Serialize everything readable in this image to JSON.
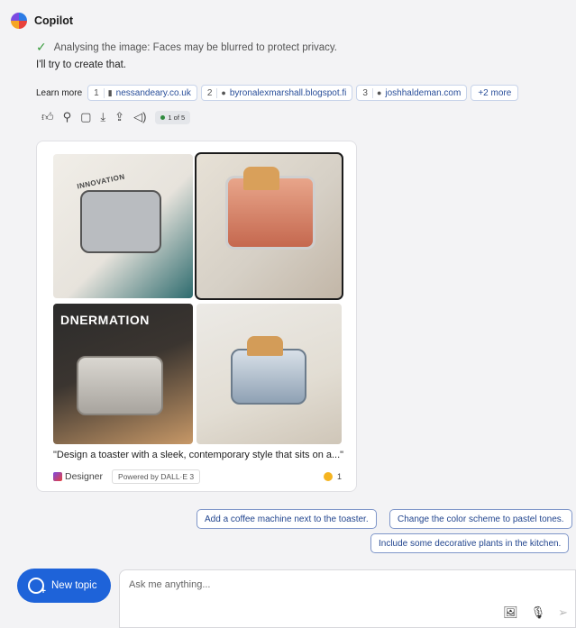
{
  "header": {
    "title": "Copilot"
  },
  "status": {
    "text": "Analysing the image: Faces may be blurred to protect privacy."
  },
  "reply": {
    "text": "I'll try to create that."
  },
  "learn_more": {
    "label": "Learn more",
    "sources": [
      {
        "num": "1",
        "name": "nessandeary.co.uk"
      },
      {
        "num": "2",
        "name": "byronalexmarshall.blogspot.fi"
      },
      {
        "num": "3",
        "name": "joshhaldeman.com"
      }
    ],
    "more_label": "+2 more"
  },
  "actions": {
    "pager": "1 of 5"
  },
  "image_card": {
    "tiles": [
      {
        "caption": "INNOVATION"
      },
      {
        "caption": ""
      },
      {
        "caption": "DNERMATION"
      },
      {
        "caption": ""
      }
    ],
    "selected_index": 1,
    "prompt": "\"Design a toaster with a sleek, contemporary style that sits on a...\"",
    "designer_label": "Designer",
    "powered_by": "Powered by DALL·E 3",
    "reaction_count": "1"
  },
  "suggestions": [
    "Add a coffee machine next to the toaster.",
    "Change the color scheme to pastel tones.",
    "Include some decorative plants in the kitchen."
  ],
  "new_topic": {
    "label": "New topic"
  },
  "composer": {
    "placeholder": "Ask me anything..."
  },
  "colors": {
    "accent": "#1e63d9",
    "chip_border": "#c8d4ea",
    "suggestion_text": "#23468f"
  }
}
